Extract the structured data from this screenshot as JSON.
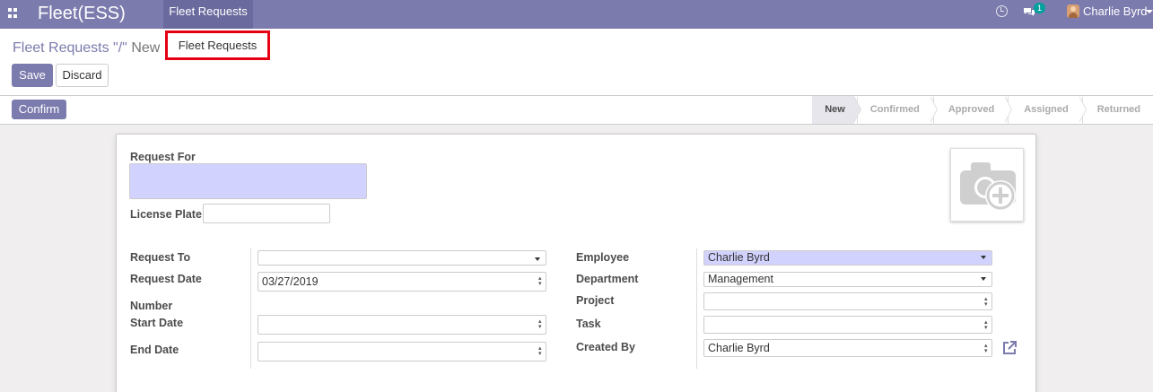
{
  "navbar": {
    "brand": "Fleet(ESS)",
    "menu_item": "Fleet Requests",
    "chat_badge": "1",
    "user_name": "Charlie Byrd",
    "bg_color": "#7c7bad"
  },
  "dropdown": {
    "item": "Fleet Requests"
  },
  "control_panel": {
    "breadcrumb_parent": "Fleet Requests \"/\"",
    "breadcrumb_current": "New",
    "save_label": "Save",
    "discard_label": "Discard"
  },
  "statusbar": {
    "confirm_label": "Confirm",
    "stages": [
      "New",
      "Confirmed",
      "Approved",
      "Assigned",
      "Returned"
    ],
    "active_stage": "New"
  },
  "form": {
    "request_for_label": "Request For",
    "request_for_value": "",
    "license_plate_label": "License Plate",
    "license_plate_value": "",
    "request_to_label": "Request To",
    "request_to_value": "",
    "request_date_label": "Request Date",
    "request_date_value": "03/27/2019",
    "number_label": "Number",
    "start_date_label": "Start Date",
    "start_date_value": "",
    "end_date_label": "End Date",
    "end_date_value": "",
    "employee_label": "Employee",
    "employee_value": "Charlie Byrd",
    "department_label": "Department",
    "department_value": "Management",
    "project_label": "Project",
    "project_value": "",
    "task_label": "Task",
    "task_value": "",
    "created_by_label": "Created By",
    "created_by_value": "Charlie Byrd"
  },
  "icons": {
    "apps": "apps-grid-icon",
    "clock": "clock-icon",
    "chat": "chat-icon",
    "photo": "camera-plus-icon",
    "external": "external-link-icon"
  }
}
